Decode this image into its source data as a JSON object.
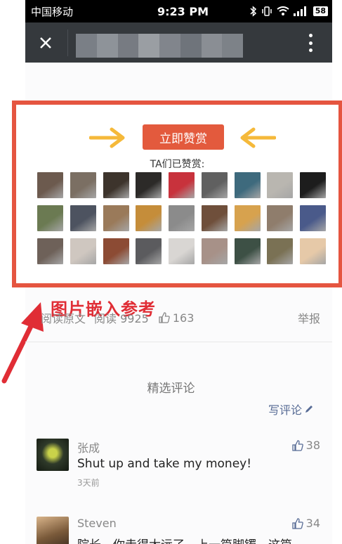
{
  "status_bar": {
    "carrier": "中国移动",
    "time": "9:23 PM",
    "battery": "58"
  },
  "title_bar": {
    "close_icon": "close-icon",
    "menu_icon": "more-vertical-icon"
  },
  "reward": {
    "button_label": "立即赞赏",
    "rewarded_label": "TA们已赞赏:",
    "avatars": [
      "#6c5a4e",
      "#7b6f63",
      "#3d342c",
      "#2c2a28",
      "#c8323c",
      "#606060",
      "#3e6a7d",
      "#b9b6b0",
      "#1d1d1d",
      "#6b7a52",
      "#4d5360",
      "#9a7a5a",
      "#c58d3a",
      "#8b8b8b",
      "#6f4f3b",
      "#d7a24e",
      "#8f7d6c",
      "#4a5a8a",
      "#6e6159",
      "#cfc7c0",
      "#8c4b34",
      "#5b5b5e",
      "#d9d6d3",
      "#a79188",
      "#3d5045",
      "#7a7154",
      "#e6c9a8"
    ]
  },
  "annotation": "图片嵌入参考",
  "meta": {
    "read_original": "阅读原文",
    "reads": "阅读 9925",
    "likes": "163",
    "report": "举报"
  },
  "comments_section": {
    "heading": "精选评论",
    "write_comment": "写评论"
  },
  "comments": [
    {
      "name": "张成",
      "likes": "38",
      "text": "Shut up and take my money!",
      "time": "3天前",
      "avatar_color": "#2f3a2a"
    },
    {
      "name": "Steven",
      "likes": "34",
      "text": "院长，你走得太远了，上一篇脚镯，这篇",
      "time": "",
      "avatar_color": "#7a5a3a"
    }
  ],
  "colors": {
    "accent_red": "#e55540",
    "reward_button": "#e35a3d",
    "arrow_yellow": "#f5b93a",
    "link_blue": "#576b95"
  }
}
